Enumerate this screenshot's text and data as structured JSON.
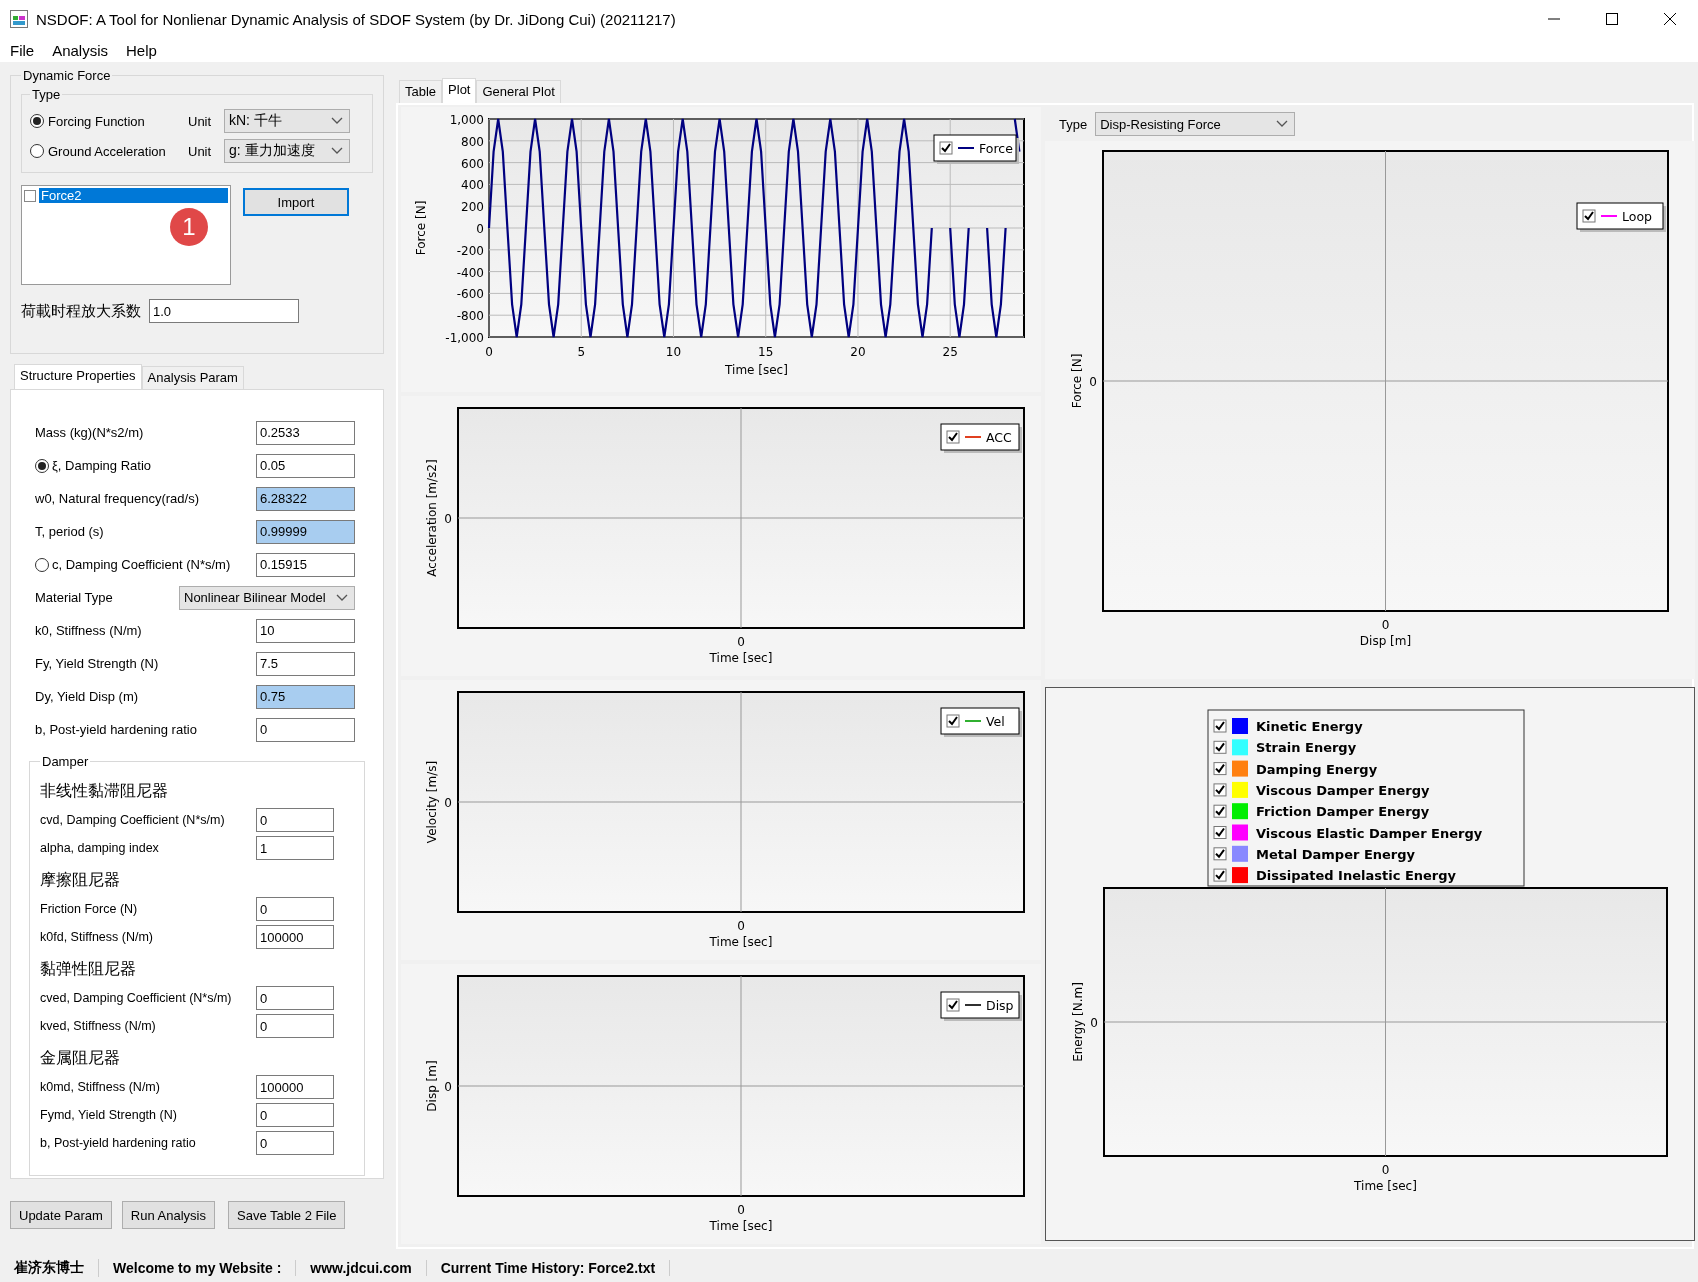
{
  "window": {
    "title": "NSDOF: A Tool for Nonlienar Dynamic Analysis of SDOF System (by Dr. JiDong Cui) (20211217)"
  },
  "menu": [
    "File",
    "Analysis",
    "Help"
  ],
  "dynamic_force": {
    "title": "Dynamic Force",
    "type_group": {
      "title": "Type",
      "options": [
        {
          "label": "Forcing Function",
          "selected": true,
          "unit_label": "Unit",
          "unit_value": "kN: 千牛"
        },
        {
          "label": "Ground Acceleration",
          "selected": false,
          "unit_label": "Unit",
          "unit_value": "g: 重力加速度"
        }
      ]
    },
    "list": [
      {
        "label": "Force2",
        "checked": false,
        "selected": true
      }
    ],
    "badge": "1",
    "import_button": "Import",
    "scale": {
      "label": "荷載时程放大系数",
      "value": "1.0"
    }
  },
  "property_tabs": [
    {
      "label": "Structure Properties",
      "selected": true
    },
    {
      "label": "Analysis Param",
      "selected": false
    }
  ],
  "params": [
    {
      "kind": "field",
      "label": "Mass (kg)(N*s2/m)",
      "value": "0.2533",
      "highlighted": false
    },
    {
      "kind": "radio",
      "label": "ξ, Damping Ratio",
      "value": "0.05",
      "selected": true,
      "highlighted": false
    },
    {
      "kind": "field",
      "label": "w0, Natural frequency(rad/s)",
      "value": "6.28322",
      "highlighted": true
    },
    {
      "kind": "field",
      "label": "T, period (s)",
      "value": "0.99999",
      "highlighted": true
    },
    {
      "kind": "radio",
      "label": "c, Damping Coefficient (N*s/m)",
      "value": "0.15915",
      "selected": false,
      "highlighted": false
    },
    {
      "kind": "select",
      "label": "Material Type",
      "value": "Nonlinear Bilinear Model"
    },
    {
      "kind": "field",
      "label": "k0, Stiffness (N/m)",
      "value": "10",
      "highlighted": false
    },
    {
      "kind": "field",
      "label": "Fy, Yield Strength (N)",
      "value": "7.5",
      "highlighted": false
    },
    {
      "kind": "field",
      "label": "Dy, Yield Disp (m)",
      "value": "0.75",
      "highlighted": true
    },
    {
      "kind": "field",
      "label": "b, Post-yield hardening ratio",
      "value": "0",
      "highlighted": false
    }
  ],
  "damper": {
    "title": "Damper",
    "sections": [
      {
        "heading": "非线性黏滞阻尼器",
        "rows": [
          {
            "label": "cvd, Damping Coefficient (N*s/m)",
            "value": "0"
          },
          {
            "label": "alpha, damping index",
            "value": "1"
          }
        ]
      },
      {
        "heading": "摩擦阻尼器",
        "rows": [
          {
            "label": "Friction Force (N)",
            "value": "0"
          },
          {
            "label": "k0fd, Stiffness (N/m)",
            "value": "100000"
          }
        ]
      },
      {
        "heading": "黏弹性阻尼器",
        "rows": [
          {
            "label": "cved, Damping Coefficient (N*s/m)",
            "value": "0"
          },
          {
            "label": "kved, Stiffness (N/m)",
            "value": "0"
          }
        ]
      },
      {
        "heading": "金属阻尼器",
        "rows": [
          {
            "label": "k0md, Stiffness (N/m)",
            "value": "100000"
          },
          {
            "label": "Fymd, Yield Strength (N)",
            "value": "0"
          },
          {
            "label": "b, Post-yield hardening ratio",
            "value": "0"
          }
        ]
      }
    ]
  },
  "buttons": [
    "Update Param",
    "Run Analysis",
    "Save Table 2 File"
  ],
  "view_tabs": [
    {
      "label": "Table",
      "selected": false
    },
    {
      "label": "Plot",
      "selected": true
    },
    {
      "label": "General Plot",
      "selected": false
    }
  ],
  "plots": [
    {
      "kind": "chart",
      "legend": {
        "checked": true
      },
      "chart_data": {
        "type": "line",
        "xlabel": "Time [sec]",
        "ylabel": "Force [N]",
        "x": [
          0,
          0.25,
          0.5,
          0.75,
          1,
          1.25,
          1.5,
          1.75,
          2,
          2.25,
          2.5,
          2.75,
          3,
          3.25,
          3.5,
          3.75,
          4,
          4.25,
          4.5,
          4.75,
          5,
          5.25,
          5.5,
          5.75,
          6,
          6.25,
          6.5,
          6.75,
          7,
          7.25,
          7.5,
          7.75,
          8,
          8.25,
          8.5,
          8.75,
          9,
          9.25,
          9.5,
          9.75,
          10,
          10.25,
          10.5,
          10.75,
          11,
          11.25,
          11.5,
          11.75,
          12,
          12.25,
          12.5,
          12.75,
          13,
          13.25,
          13.5,
          13.75,
          14,
          14.25,
          14.5,
          14.75,
          15,
          15.25,
          15.5,
          15.75,
          16,
          16.25,
          16.5,
          16.75,
          17,
          17.25,
          17.5,
          17.75,
          18,
          18.25,
          18.5,
          18.75,
          19,
          19.25,
          19.5,
          19.75,
          20,
          20.25,
          20.5,
          20.75,
          21,
          21.25,
          21.5,
          21.75,
          22,
          22.25,
          22.5,
          22.75,
          23,
          23.25,
          23.5,
          23.75,
          24,
          24.25,
          24.5,
          24.75,
          25,
          25.25,
          25.5,
          25.75,
          26,
          26.25,
          26.5,
          26.75,
          27,
          27.25,
          27.5,
          27.75,
          28,
          28.25,
          28.5,
          28.75
        ],
        "series": [
          {
            "name": "Force",
            "color": "#000080",
            "values": [
              0,
              700,
              1000,
              700,
              0,
              -700,
              -1000,
              -700,
              0,
              700,
              1000,
              700,
              0,
              -700,
              -1000,
              -700,
              0,
              700,
              1000,
              700,
              0,
              -700,
              -1000,
              -700,
              0,
              700,
              1000,
              700,
              0,
              -700,
              -1000,
              -700,
              0,
              700,
              1000,
              700,
              0,
              -700,
              -1000,
              -700,
              0,
              700,
              1000,
              700,
              0,
              -700,
              -1000,
              -700,
              0,
              700,
              1000,
              700,
              0,
              -700,
              -1000,
              -700,
              0,
              700,
              1000,
              700,
              0,
              -700,
              -1000,
              -700,
              0,
              700,
              1000,
              700,
              0,
              -700,
              -1000,
              -700,
              0,
              700,
              1000,
              700,
              0,
              -700,
              -1000,
              -700,
              0,
              700,
              1000,
              700,
              0,
              -700,
              -1000,
              -700,
              0,
              700,
              1000,
              700,
              0,
              -700,
              -1000,
              -700,
              0,
              null,
              null,
              null,
              0,
              -700,
              -1000,
              -700,
              0,
              null,
              null,
              null,
              0,
              -700,
              -1000,
              -700,
              0,
              null,
              1000,
              700
            ]
          }
        ],
        "grid": true,
        "xlim": [
          0,
          29
        ],
        "ylim": [
          -1000,
          1000
        ],
        "xticks": [
          0,
          5,
          10,
          15,
          20,
          25
        ],
        "yticks": [
          {
            "value": 1000,
            "label": "1,000"
          },
          800,
          600,
          400,
          200,
          0,
          -200,
          -400,
          -600,
          -800,
          {
            "value": -1000,
            "label": "-1,000"
          }
        ]
      }
    },
    {
      "kind": "empty",
      "ylabel": "Acceleration [m/s2]",
      "xlabel": "Time [sec]",
      "ytick": "0",
      "xtick": "0",
      "legend": {
        "label": "ACC",
        "color": "#e04020",
        "checked": true
      }
    },
    {
      "kind": "empty",
      "ylabel": "Velocity [m/s]",
      "xlabel": "Time [sec]",
      "ytick": "0",
      "xtick": "0",
      "legend": {
        "label": "Vel",
        "color": "#30b030",
        "checked": true
      }
    },
    {
      "kind": "empty",
      "ylabel": "Disp [m]",
      "xlabel": "Time [sec]",
      "ytick": "0",
      "xtick": "0",
      "legend": {
        "label": "Disp",
        "color": "#303030",
        "checked": true
      }
    }
  ],
  "type_selector": {
    "label": "Type",
    "value": "Disp-Resisting Force"
  },
  "loop_plot": {
    "kind": "empty",
    "ylabel": "Force [N]",
    "xlabel": "Disp [m]",
    "ytick": "0",
    "xtick": "0",
    "legend": {
      "label": "Loop",
      "color": "#ff00ff",
      "checked": true
    }
  },
  "energy_plot": {
    "ylabel": "Energy [N.m]",
    "xlabel": "Time [sec]",
    "ytick": "0",
    "xtick": "0",
    "legend": [
      {
        "label": "Kinetic Energy",
        "color": "#0000ff",
        "checked": true
      },
      {
        "label": "Strain Energy",
        "color": "#33ffff",
        "checked": true
      },
      {
        "label": "Damping Energy",
        "color": "#ff8010",
        "checked": true
      },
      {
        "label": "Viscous Damper Energy",
        "color": "#ffff00",
        "checked": true
      },
      {
        "label": "Friction Damper Energy",
        "color": "#00ee00",
        "checked": true
      },
      {
        "label": "Viscous Elastic Damper Energy",
        "color": "#ff00ff",
        "checked": true
      },
      {
        "label": "Metal Damper Energy",
        "color": "#8888ff",
        "checked": true
      },
      {
        "label": "Dissipated Inelastic Energy",
        "color": "#ff0000",
        "checked": true
      }
    ]
  },
  "status_bar": [
    "崔济东博士",
    "Welcome to my Website :",
    "www.jdcui.com",
    "Current Time History: Force2.txt"
  ]
}
